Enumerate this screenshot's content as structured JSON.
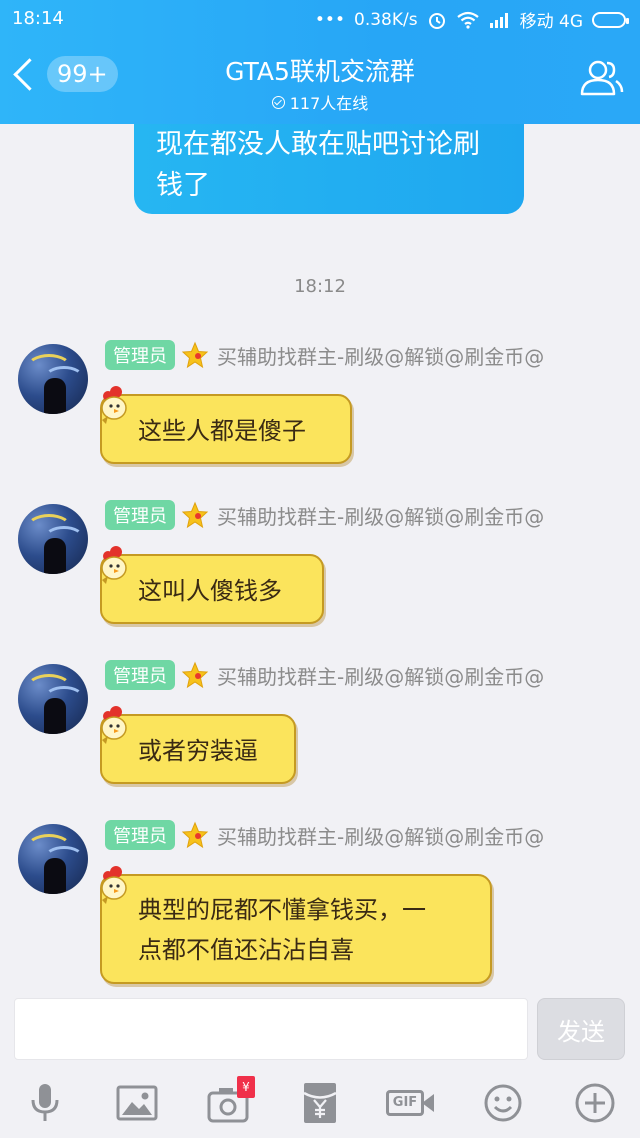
{
  "status_bar": {
    "time": "18:14",
    "net_speed": "0.38K/s",
    "carrier": "移动 4G"
  },
  "header": {
    "unread_count": "99+",
    "title": "GTA5联机交流群",
    "online_count": "117人在线"
  },
  "messages": {
    "previous_bubble_text": "现在都没人敢在贴吧讨论刷钱了",
    "timestamp": "18:12",
    "items": [
      {
        "role": "管理员",
        "sender": "买辅助找群主-刷级@解锁@刷金币@",
        "text": "这些人都是傻子"
      },
      {
        "role": "管理员",
        "sender": "买辅助找群主-刷级@解锁@刷金币@",
        "text": "这叫人傻钱多"
      },
      {
        "role": "管理员",
        "sender": "买辅助找群主-刷级@解锁@刷金币@",
        "text": "或者穷装逼"
      },
      {
        "role": "管理员",
        "sender": "买辅助找群主-刷级@解锁@刷金币@",
        "text_line1": "典型的屁都不懂拿钱买，一",
        "text_line2": "点都不值还沾沾自喜"
      }
    ]
  },
  "input": {
    "send_label": "发送"
  },
  "toolbar": {
    "redpacket_badge": "¥",
    "gif_label": "GIF"
  },
  "colors": {
    "header_blue": "#27a6f6",
    "admin_green": "#6fd7a4",
    "bubble_yellow": "#fbe45c",
    "send_gray": "#dcdde2"
  }
}
